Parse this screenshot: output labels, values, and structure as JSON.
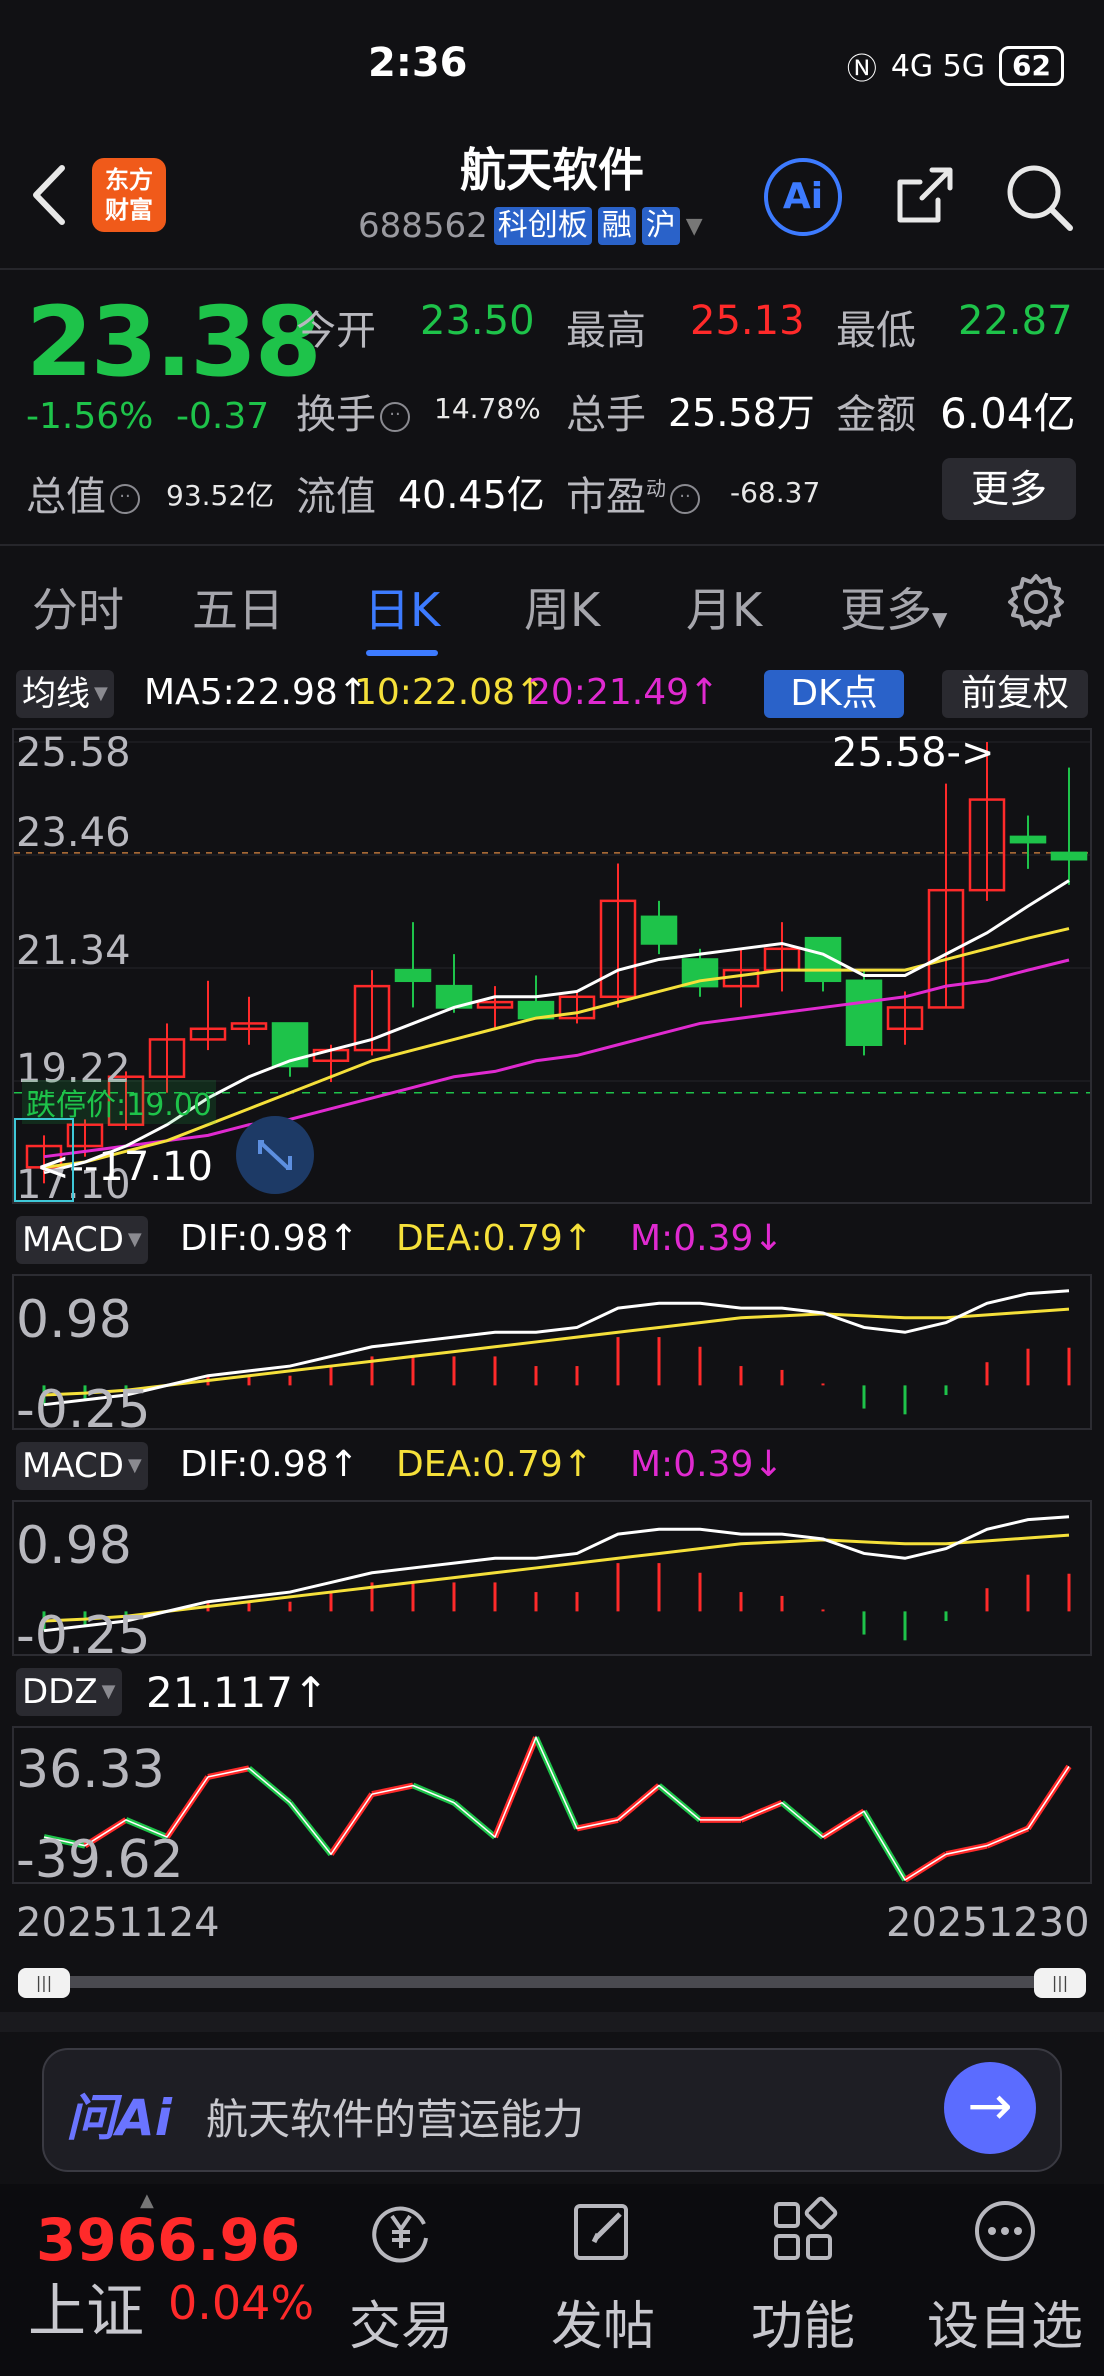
{
  "status_bar": {
    "time": "2:36",
    "network": "4G 5G",
    "battery": "62"
  },
  "header": {
    "logo_text_1": "东方",
    "logo_text_2": "财富",
    "stock_name": "航天软件",
    "stock_code": "688562",
    "tags": [
      "科创板",
      "融",
      "沪"
    ],
    "ai_label": "Ai"
  },
  "quote": {
    "price": "23.38",
    "pct_change": "-1.56%",
    "change": "-0.37",
    "open_label": "今开",
    "open": "23.50",
    "high_label": "最高",
    "high": "25.13",
    "low_label": "最低",
    "low": "22.87",
    "turnover_label": "换手",
    "turnover": "14.78%",
    "volume_label": "总手",
    "volume": "25.58万",
    "amount_label": "金额",
    "amount": "6.04亿",
    "mcap_label": "总值",
    "mcap": "93.52亿",
    "float_label": "流值",
    "float_mcap": "40.45亿",
    "pe_label": "市盈",
    "pe_sup": "动",
    "pe": "-68.37",
    "more_label": "更多"
  },
  "tabs": [
    "分时",
    "五日",
    "日K",
    "周K",
    "月K",
    "更多"
  ],
  "active_tab": 2,
  "kline": {
    "ma_selector": "均线",
    "ma5": "MA5:22.98↑",
    "ma10": "10:22.08↑",
    "ma20": "20:21.49↑",
    "dk_label": "DK点",
    "fq_label": "前复权",
    "y_labels": [
      "25.58",
      "23.46",
      "21.34",
      "19.22",
      "17.10"
    ],
    "max_marker": "25.58->",
    "min_marker": "<--17.10",
    "limit_down": "跌停价:19.00"
  },
  "macd1": {
    "selector": "MACD",
    "dif": "DIF:0.98↑",
    "dea": "DEA:0.79↑",
    "m": "M:0.39↓",
    "y_top": "0.98",
    "y_bottom": "-0.25"
  },
  "macd2": {
    "selector": "MACD",
    "dif": "DIF:0.98↑",
    "dea": "DEA:0.79↑",
    "m": "M:0.39↓",
    "y_top": "0.98",
    "y_bottom": "-0.25"
  },
  "ddz": {
    "selector": "DDZ",
    "value": "21.117↑",
    "y_top": "36.33",
    "y_bottom": "-39.62"
  },
  "dates": {
    "start": "20251124",
    "end": "20251230"
  },
  "ai_search": {
    "logo": "问Ai",
    "prompt": "航天软件的营运能力"
  },
  "bottom_nav": {
    "index_value": "3966.96",
    "index_name": "上证",
    "index_pct": "0.04%",
    "items": [
      "交易",
      "发帖",
      "功能",
      "设自选"
    ]
  },
  "colors": {
    "up": "#ff2a2a",
    "down": "#1ec34a",
    "accent": "#3d7bff",
    "ma5": "#ffffff",
    "ma10": "#f5e03a",
    "ma20": "#e02ad0"
  },
  "chart_data": {
    "type": "candlestick",
    "x_range": [
      "20251124",
      "20251230"
    ],
    "ylim": [
      17.1,
      25.58
    ],
    "candles": [
      {
        "o": 17.6,
        "h": 18.2,
        "l": 17.3,
        "c": 18.0
      },
      {
        "o": 18.0,
        "h": 18.5,
        "l": 17.8,
        "c": 18.4
      },
      {
        "o": 18.4,
        "h": 19.4,
        "l": 18.3,
        "c": 19.3
      },
      {
        "o": 19.3,
        "h": 20.3,
        "l": 19.0,
        "c": 20.0
      },
      {
        "o": 20.0,
        "h": 21.1,
        "l": 19.8,
        "c": 20.2
      },
      {
        "o": 20.2,
        "h": 20.8,
        "l": 19.9,
        "c": 20.3
      },
      {
        "o": 20.3,
        "h": 20.3,
        "l": 19.3,
        "c": 19.5
      },
      {
        "o": 19.6,
        "h": 19.9,
        "l": 19.2,
        "c": 19.8
      },
      {
        "o": 19.8,
        "h": 21.3,
        "l": 19.7,
        "c": 21.0
      },
      {
        "o": 21.3,
        "h": 22.2,
        "l": 20.6,
        "c": 21.1
      },
      {
        "o": 21.0,
        "h": 21.6,
        "l": 20.5,
        "c": 20.6
      },
      {
        "o": 20.6,
        "h": 21.0,
        "l": 20.2,
        "c": 20.7
      },
      {
        "o": 20.7,
        "h": 21.2,
        "l": 20.4,
        "c": 20.4
      },
      {
        "o": 20.4,
        "h": 20.9,
        "l": 20.3,
        "c": 20.8
      },
      {
        "o": 20.8,
        "h": 23.3,
        "l": 20.6,
        "c": 22.6
      },
      {
        "o": 22.3,
        "h": 22.6,
        "l": 21.6,
        "c": 21.8
      },
      {
        "o": 21.5,
        "h": 21.7,
        "l": 20.8,
        "c": 21.0
      },
      {
        "o": 21.0,
        "h": 21.7,
        "l": 20.6,
        "c": 21.3
      },
      {
        "o": 21.3,
        "h": 22.2,
        "l": 20.9,
        "c": 21.7
      },
      {
        "o": 21.9,
        "h": 21.9,
        "l": 20.9,
        "c": 21.1
      },
      {
        "o": 21.1,
        "h": 21.3,
        "l": 19.7,
        "c": 19.9
      },
      {
        "o": 20.2,
        "h": 20.9,
        "l": 19.9,
        "c": 20.6
      },
      {
        "o": 20.6,
        "h": 24.8,
        "l": 20.6,
        "c": 22.8
      },
      {
        "o": 22.8,
        "h": 25.58,
        "l": 22.6,
        "c": 24.5
      },
      {
        "o": 23.8,
        "h": 24.2,
        "l": 23.2,
        "c": 23.7
      },
      {
        "o": 23.5,
        "h": 25.1,
        "l": 22.9,
        "c": 23.38
      }
    ],
    "ma5": [
      17.5,
      17.7,
      18.0,
      18.4,
      18.9,
      19.3,
      19.6,
      19.8,
      20.0,
      20.3,
      20.6,
      20.8,
      20.8,
      20.9,
      21.3,
      21.5,
      21.6,
      21.7,
      21.8,
      21.6,
      21.2,
      21.2,
      21.6,
      22.0,
      22.5,
      22.98
    ],
    "ma10": [
      17.6,
      17.7,
      17.9,
      18.1,
      18.4,
      18.7,
      19.0,
      19.3,
      19.6,
      19.8,
      20.0,
      20.2,
      20.4,
      20.5,
      20.7,
      20.9,
      21.1,
      21.2,
      21.3,
      21.3,
      21.3,
      21.3,
      21.5,
      21.7,
      21.9,
      22.08
    ],
    "ma20": [
      17.8,
      17.9,
      18.0,
      18.1,
      18.2,
      18.4,
      18.5,
      18.7,
      18.9,
      19.1,
      19.3,
      19.4,
      19.6,
      19.7,
      19.9,
      20.1,
      20.3,
      20.4,
      20.5,
      20.6,
      20.7,
      20.8,
      21.0,
      21.1,
      21.3,
      21.49
    ],
    "macd_dif": [
      -0.2,
      -0.15,
      -0.1,
      0.0,
      0.1,
      0.15,
      0.2,
      0.3,
      0.4,
      0.45,
      0.5,
      0.55,
      0.55,
      0.6,
      0.8,
      0.85,
      0.85,
      0.8,
      0.8,
      0.75,
      0.6,
      0.55,
      0.65,
      0.85,
      0.95,
      0.98
    ],
    "macd_dea": [
      -0.1,
      -0.08,
      -0.05,
      0.0,
      0.05,
      0.1,
      0.15,
      0.2,
      0.25,
      0.3,
      0.35,
      0.4,
      0.45,
      0.5,
      0.55,
      0.6,
      0.65,
      0.7,
      0.72,
      0.74,
      0.72,
      0.7,
      0.7,
      0.73,
      0.76,
      0.79
    ],
    "macd_m": [
      -0.2,
      -0.14,
      -0.1,
      0.0,
      0.1,
      0.1,
      0.1,
      0.2,
      0.3,
      0.3,
      0.3,
      0.3,
      0.2,
      0.2,
      0.5,
      0.5,
      0.4,
      0.2,
      0.16,
      0.02,
      -0.24,
      -0.3,
      -0.1,
      0.24,
      0.38,
      0.39
    ],
    "ddz": [
      -20,
      -25,
      -10,
      -20,
      15,
      20,
      0,
      -30,
      5,
      10,
      0,
      -20,
      38,
      -15,
      -10,
      10,
      -10,
      -10,
      0,
      -20,
      -5,
      -45,
      -30,
      -25,
      -15,
      21.117
    ]
  }
}
